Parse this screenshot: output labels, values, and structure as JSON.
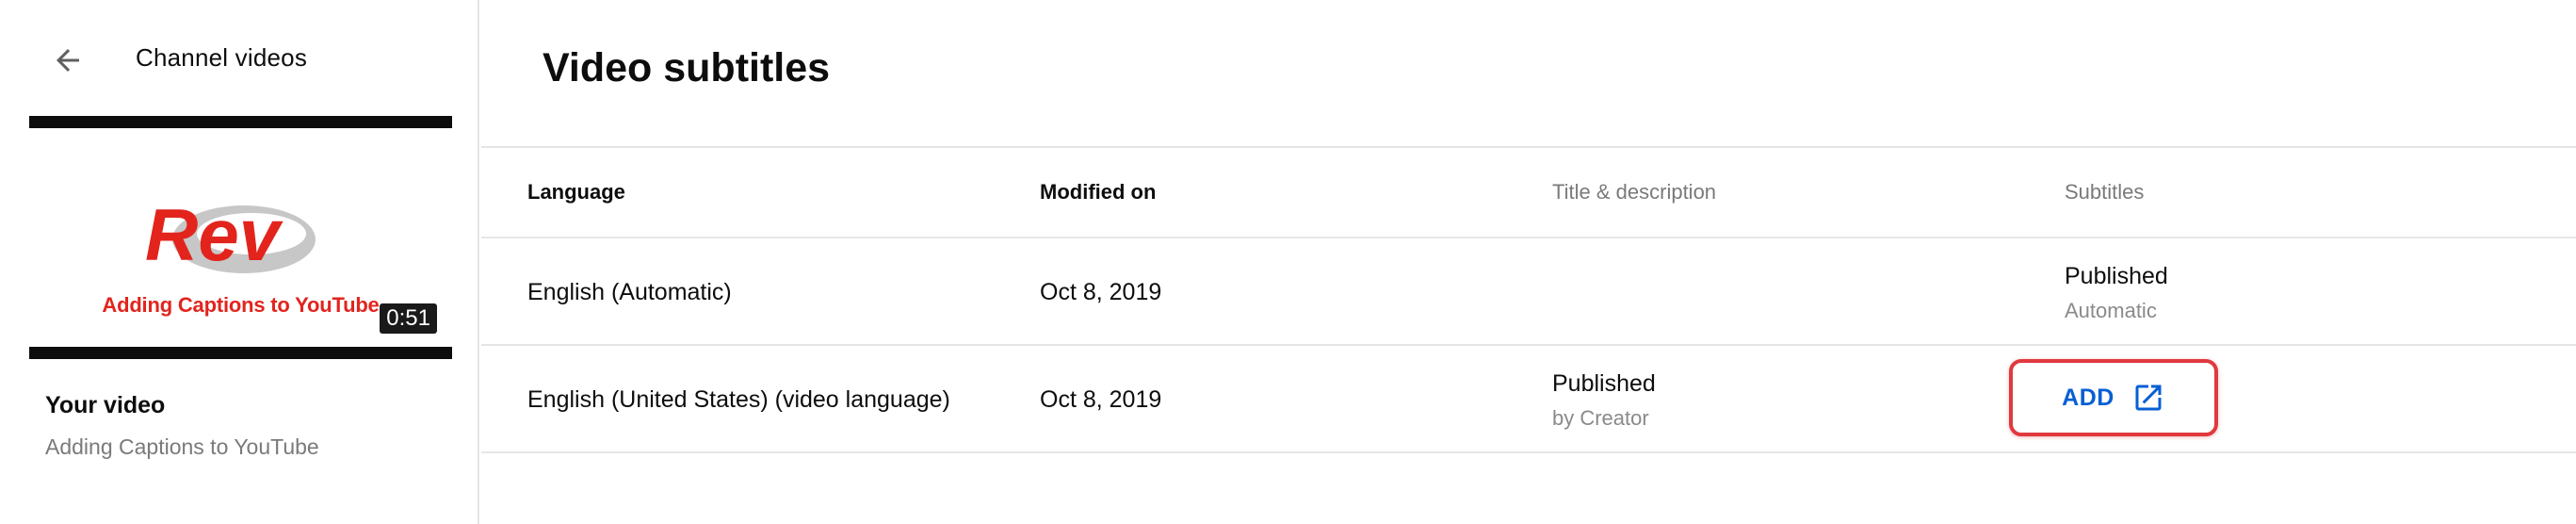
{
  "sidebar": {
    "back_icon": "arrow-left-icon",
    "title": "Channel videos",
    "thumbnail": {
      "logo_text": "Rev",
      "caption_text": "Adding Captions to YouTube",
      "duration": "0:51",
      "brand_color": "#e2241d"
    },
    "your_video_label": "Your video",
    "video_name": "Adding Captions to YouTube"
  },
  "main": {
    "title": "Video subtitles",
    "table": {
      "headers": {
        "language": "Language",
        "modified": "Modified on",
        "title_desc": "Title & description",
        "subtitles": "Subtitles"
      },
      "rows": [
        {
          "language": "English (Automatic)",
          "modified": "Oct 8, 2019",
          "title_desc": "",
          "title_desc_sub": "",
          "subtitles": "Published",
          "subtitles_sub": "Automatic"
        },
        {
          "language": "English (United States) (video language)",
          "modified": "Oct 8, 2019",
          "title_desc": "Published",
          "title_desc_sub": "by Creator",
          "subtitles_action": "ADD",
          "subtitles_action_icon": "open-in-new-icon"
        }
      ]
    }
  },
  "colors": {
    "accent": "#065fd4",
    "highlight": "#e0393e",
    "divider": "#e5e5e5",
    "muted_text": "#7a7a7a"
  }
}
